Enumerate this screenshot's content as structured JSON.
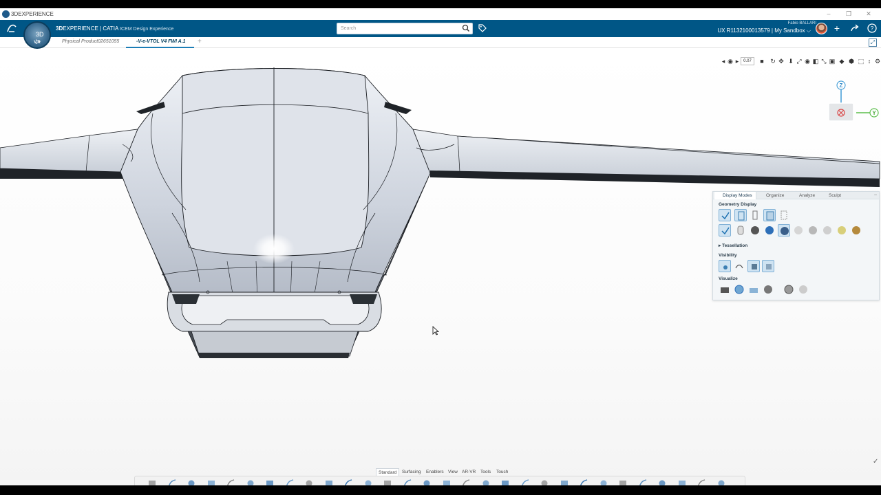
{
  "window": {
    "title": "3DEXPERIENCE",
    "minimize": "–",
    "restore": "❐",
    "close": "✕"
  },
  "topbar": {
    "brand_bold": "3D",
    "brand_main": "EXPERIENCE | CATIA",
    "brand_app": "ICEM Design Experience",
    "compass_version": "V.R",
    "compass_mid": "3D ▷",
    "search_placeholder": "Search",
    "user_name": "Fabio BALLARI",
    "context": "UX R1132100013579 | My Sandbox",
    "context_caret": "⌵",
    "colors": {
      "bar": "#005686",
      "accent": "#1b7db6"
    }
  },
  "tabs": [
    {
      "label": "Physical Product02651055",
      "active": false
    },
    {
      "label": "-V-e-VTOL V4 FWI A.1",
      "active": true
    }
  ],
  "tab_add": "+",
  "viewtools": {
    "zoom_value": "0.07"
  },
  "axes": {
    "z": "Z",
    "y": "Y"
  },
  "panel": {
    "tabs": [
      "Display Modes",
      "Organize",
      "Analyze",
      "Sculpt"
    ],
    "sections": {
      "geometry": "Geometry Display",
      "tessellation": "Tessellation",
      "visibility": "Visibility",
      "visualize": "Visualize"
    },
    "geometry_row1": [
      "check-icon",
      "edges-icon",
      "points-icon",
      "surfaces-icon",
      "mesh-icon"
    ],
    "geometry_row2": [
      "check-icon",
      "cylinder-icon",
      "dark-sphere-icon",
      "blue-sphere-icon",
      "blue-shaded-icon",
      "grey-sphere-icon",
      "silver-sphere-icon",
      "white-sphere-icon",
      "gold-sphere-icon",
      "bronze-sphere-icon"
    ],
    "visibility_icons": [
      "show-icon",
      "hide-icon",
      "cube-visible-icon",
      "swap-icon"
    ],
    "visualize_icons": [
      "film-icon",
      "globe-icon",
      "scene-icon",
      "sphere-icon",
      "settings-sphere-icon",
      "render-icon"
    ]
  },
  "workspace_tabs": [
    {
      "label": "Standard",
      "active": true
    },
    {
      "label": "Surfacing",
      "active": false
    },
    {
      "label": "Enablers",
      "active": false
    },
    {
      "label": "View",
      "active": false
    },
    {
      "label": "AR-VR",
      "active": false
    },
    {
      "label": "Tools",
      "active": false
    },
    {
      "label": "Touch",
      "active": false
    }
  ],
  "actionbar_icons": [
    "scissors-icon",
    "copy-icon",
    "paste-icon",
    "undo-icon",
    "redo-icon",
    "point-icon",
    "line-icon",
    "curve-icon",
    "spline-icon",
    "arc-icon",
    "surface-icon",
    "extrude-icon",
    "sweep-icon",
    "fillet-icon",
    "blend-icon",
    "offset-icon",
    "trim-icon",
    "split-icon",
    "measure-icon",
    "section-icon",
    "text-icon",
    "table-icon",
    "analysis-icon",
    "first-icon",
    "last-icon",
    "snapshot-icon",
    "move-icon",
    "align-icon",
    "capture-icon",
    "export-icon"
  ]
}
